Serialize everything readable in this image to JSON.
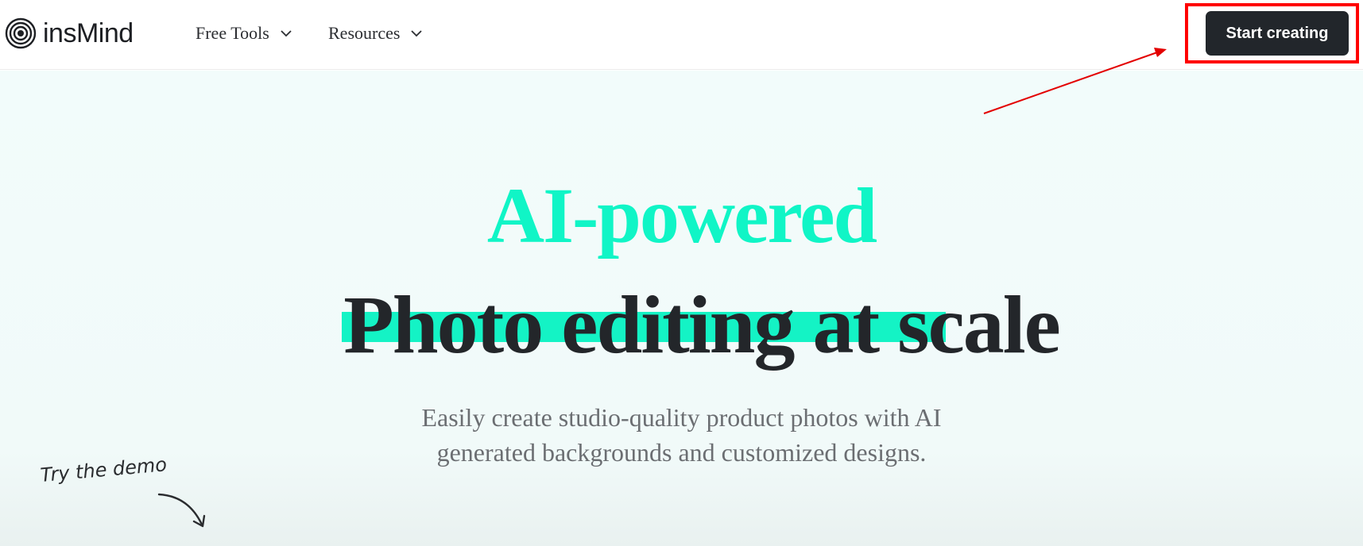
{
  "header": {
    "logo_text": "insMind",
    "nav": [
      {
        "label": "Free Tools"
      },
      {
        "label": "Resources"
      }
    ],
    "cta_label": "Start creating"
  },
  "hero": {
    "accent_heading": "AI-powered",
    "main_heading": "Photo editing at scale",
    "subtitle_line1": "Easily create studio-quality product photos with AI",
    "subtitle_line2": "generated backgrounds and customized designs.",
    "demo_label": "Try the demo"
  },
  "colors": {
    "accent": "#10f5c6",
    "dark": "#22262b",
    "annotation": "#ff0000"
  },
  "icons": [
    "logo-icon",
    "chevron-down-icon",
    "annotation-arrow",
    "curved-arrow-icon"
  ]
}
